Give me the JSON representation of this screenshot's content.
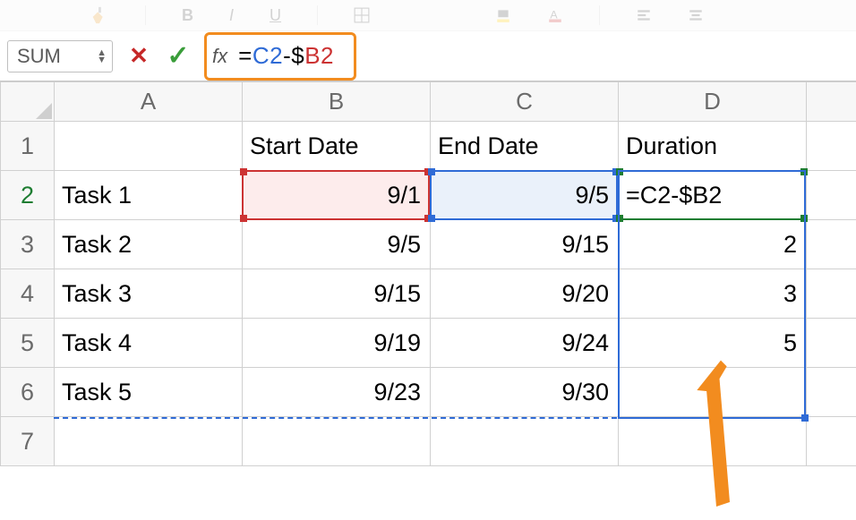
{
  "ribbon": {
    "bold": "B",
    "italic": "I",
    "underline": "U"
  },
  "formula_bar": {
    "name_box": "SUM",
    "fx_label": "fx",
    "formula_eq": "=",
    "formula_ref1": "C2",
    "formula_mid": "-$",
    "formula_ref2": "B2",
    "formula_plain": "=C2-$B2"
  },
  "columns": {
    "A": "A",
    "B": "B",
    "C": "C",
    "D": "D"
  },
  "rows": {
    "r1": "1",
    "r2": "2",
    "r3": "3",
    "r4": "4",
    "r5": "5",
    "r6": "6",
    "r7": "7"
  },
  "headers": {
    "b": "Start Date",
    "c": "End Date",
    "d": "Duration"
  },
  "data": {
    "a2": "Task 1",
    "b2": "9/1",
    "c2": "9/5",
    "d2": "=C2-$B2",
    "a3": "Task 2",
    "b3": "9/5",
    "c3": "9/15",
    "d3": "2",
    "a4": "Task 3",
    "b4": "9/15",
    "c4": "9/20",
    "d4": "3",
    "a5": "Task 4",
    "b5": "9/19",
    "c5": "9/24",
    "d5": "5",
    "a6": "Task 5",
    "b6": "9/23",
    "c6": "9/30",
    "d6": ""
  },
  "annotations": {
    "highlight_color": "#f28c1f"
  }
}
